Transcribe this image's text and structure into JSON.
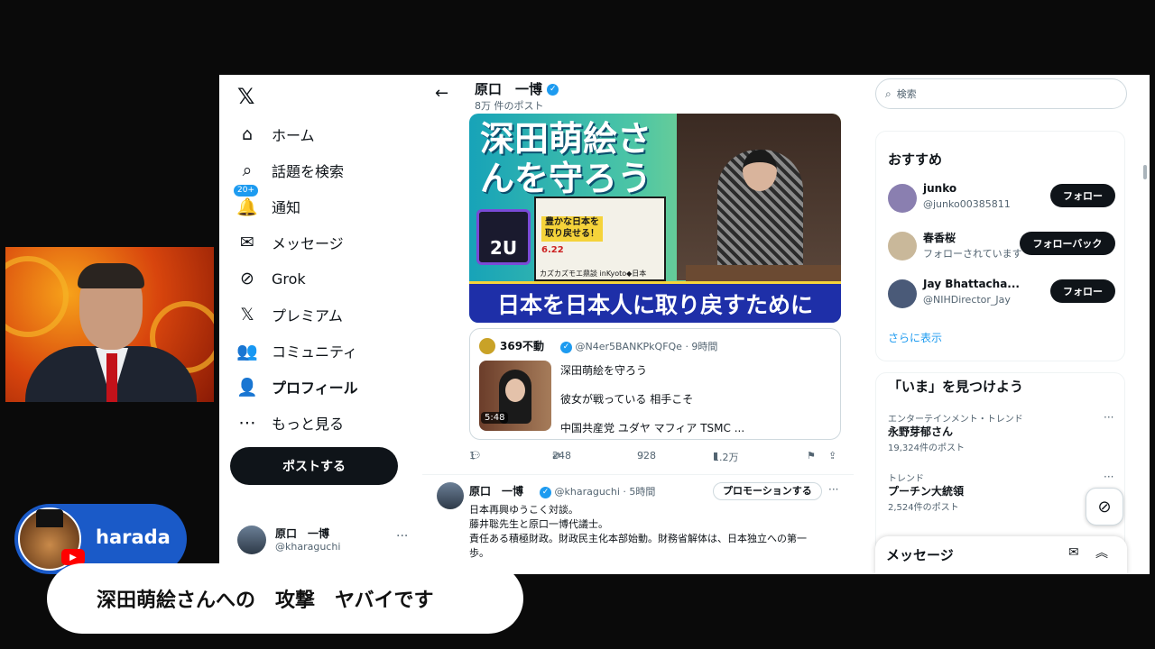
{
  "nav": {
    "items": [
      {
        "icon": "home-icon",
        "glyph": "⌂",
        "label": "ホーム"
      },
      {
        "icon": "search-icon",
        "glyph": "⌕",
        "label": "話題を検索"
      },
      {
        "icon": "bell-icon",
        "glyph": "🔔",
        "label": "通知",
        "badge": "20+"
      },
      {
        "icon": "mail-icon",
        "glyph": "✉",
        "label": "メッセージ"
      },
      {
        "icon": "grok-icon",
        "glyph": "⊘",
        "label": "Grok"
      },
      {
        "icon": "x-logo-icon",
        "glyph": "𝕏",
        "label": "プレミアム"
      },
      {
        "icon": "community-icon",
        "glyph": "👥",
        "label": "コミュニティ"
      },
      {
        "icon": "person-icon",
        "glyph": "👤",
        "label": "プロフィール"
      },
      {
        "icon": "more-circle-icon",
        "glyph": "⋯",
        "label": "もっと見る"
      }
    ],
    "post_button": "ポストする",
    "user": {
      "name": "原口　一博",
      "handle": "@kharaguchi",
      "more": "···"
    }
  },
  "profile_header": {
    "name": "原口　一博",
    "post_count": "8万 件のポスト"
  },
  "media": {
    "headline": "深田萌絵さ\nんを守ろう",
    "logo": "2U",
    "flyer_text": "豊かな日本を\n取り戻せる！",
    "flyer_date": "6.22",
    "flyer_sub": "カズカズモエ鼎談 inKyoto◆日本",
    "banner": "日本を日本人に取り戻すために"
  },
  "quote": {
    "name": "369不動",
    "handle": "@N4er5BANKPkQFQe · 9時間",
    "video_duration": "5:48",
    "lines": [
      "深田萌絵を守ろう",
      "彼女が戦っている 相手こそ",
      "中国共産党 ユダヤ マフィア TSMC ..."
    ]
  },
  "actions": {
    "replies": "1",
    "reposts": "248",
    "likes": "928",
    "views": "1.2万"
  },
  "tweet2": {
    "name": "原口　一博",
    "handle": "@kharaguchi · 5時間",
    "promo": "プロモーションする",
    "lines": [
      "日本再興ゆうこく対談。",
      "藤井聡先生と原口一博代議士。",
      "責任ある積極財政。財政民主化本部始動。財務省解体は、日本独立への第一",
      "歩。"
    ]
  },
  "search": {
    "placeholder": "検索"
  },
  "suggestions": {
    "title": "おすすめ",
    "people": [
      {
        "name": "junko",
        "handle": "@junko00385811",
        "button": "フォロー",
        "color": "#8a7fb0"
      },
      {
        "name": "春香桜",
        "handle": "フォローされています",
        "button": "フォローバック",
        "color": "#c9b89a"
      },
      {
        "name": "Jay Bhattacha...",
        "handle": "@NIHDirector_Jay",
        "button": "フォロー",
        "color": "#4a5a78"
      }
    ],
    "show_more": "さらに表示"
  },
  "trends": {
    "title": "「いま」を見つけよう",
    "items": [
      {
        "category": "エンターテインメント・トレンド",
        "name": "永野芽郁さん",
        "count": "19,324件のポスト"
      },
      {
        "category": "トレンド",
        "name": "プーチン大統領",
        "count": "2,524件のポスト"
      }
    ]
  },
  "messages_dock": {
    "title": "メッセージ"
  },
  "speaker": {
    "name": "harada"
  },
  "caption": "深田萌絵さんへの　攻撃　ヤバイです"
}
